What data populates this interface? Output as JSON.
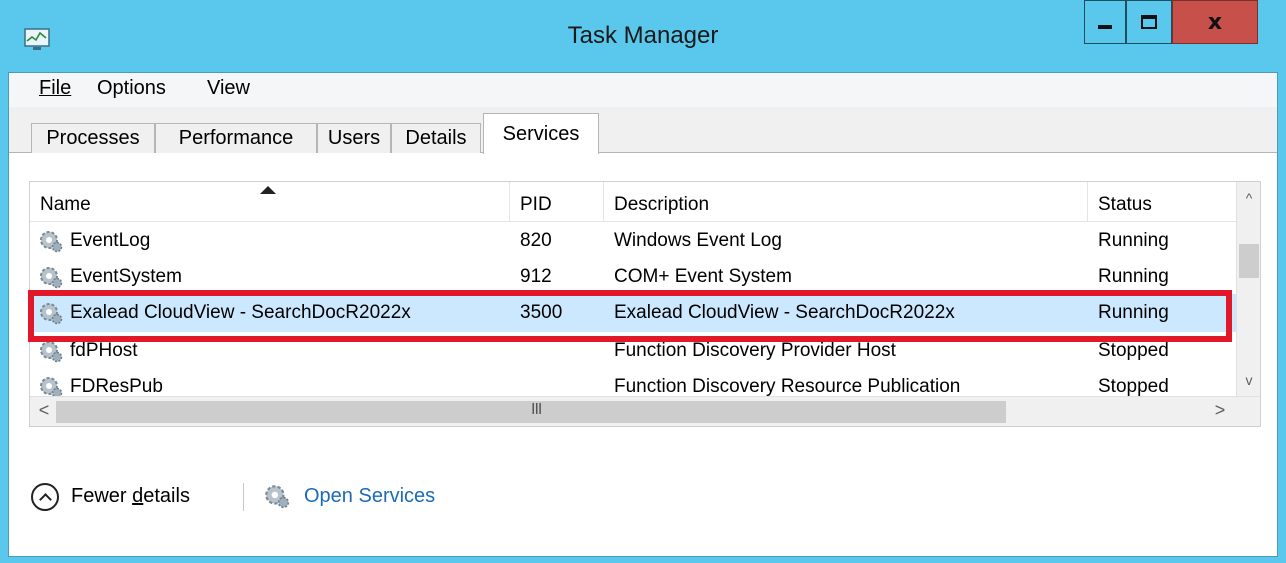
{
  "window": {
    "title": "Task Manager",
    "close_glyph": "x"
  },
  "menu": {
    "items": [
      {
        "label": "File"
      },
      {
        "label": "Options"
      },
      {
        "label": "View"
      }
    ]
  },
  "tabs": [
    {
      "label": "Processes"
    },
    {
      "label": "Performance"
    },
    {
      "label": "Users"
    },
    {
      "label": "Details"
    },
    {
      "label": "Services",
      "active": true
    }
  ],
  "table": {
    "columns": {
      "name": "Name",
      "pid": "PID",
      "description": "Description",
      "status": "Status"
    },
    "rows": [
      {
        "name": "EventLog",
        "pid": "820",
        "description": "Windows Event Log",
        "status": "Running"
      },
      {
        "name": "EventSystem",
        "pid": "912",
        "description": "COM+ Event System",
        "status": "Running"
      },
      {
        "name": "Exalead CloudView - SearchDocR2022x",
        "pid": "3500",
        "description": "Exalead CloudView - SearchDocR2022x",
        "status": "Running",
        "selected": true
      },
      {
        "name": "fdPHost",
        "pid": "",
        "description": "Function Discovery Provider Host",
        "status": "Stopped"
      },
      {
        "name": "FDResPub",
        "pid": "",
        "description": "Function Discovery Resource Publication",
        "status": "Stopped"
      }
    ]
  },
  "scroll": {
    "up_glyph": "^",
    "down_glyph": "v",
    "left_glyph": "<",
    "right_glyph": ">",
    "grip_glyph": "III"
  },
  "footer": {
    "fewer_details_prefix": "Fewer ",
    "fewer_details_underlined": "d",
    "fewer_details_suffix": "etails",
    "open_services": "Open Services"
  },
  "colors": {
    "titlebar": "#5ac8ec",
    "close_button": "#c7504a",
    "selection": "#cce8ff",
    "highlight_box": "#e0182a",
    "link": "#1c6bb6"
  },
  "icons": {
    "app": "task-manager-icon",
    "service": "gear-icon",
    "fewer": "chevron-up-icon"
  }
}
